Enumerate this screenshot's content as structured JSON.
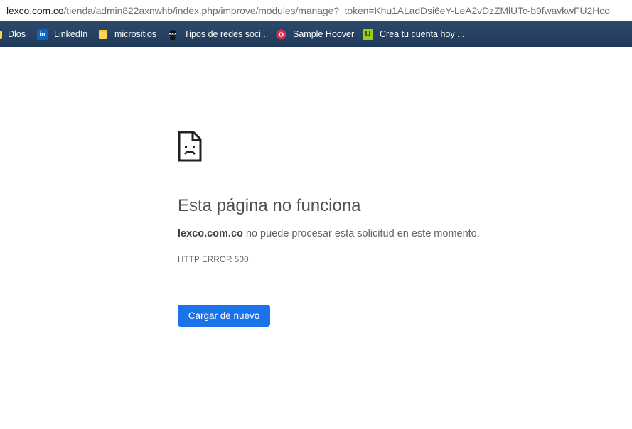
{
  "address_bar": {
    "url_domain": "lexco.com.co",
    "url_path": "/tienda/admin822axnwhb/index.php/improve/modules/manage?_token=Khu1ALadDsi6eY-LeA2vDzZMlUTc-b9fwavkwFU2Hco"
  },
  "bookmarks": {
    "items": [
      {
        "label": "Dlos",
        "icon": "bookmark-clip-icon"
      },
      {
        "label": "LinkedIn",
        "icon": "linkedin-icon",
        "icon_text": "in"
      },
      {
        "label": "micrositios",
        "icon": "folder-icon"
      },
      {
        "label": "Tipos de redes soci...",
        "icon": "ninja-icon"
      },
      {
        "label": "Sample Hoover",
        "icon": "hoover-icon"
      },
      {
        "label": "Crea tu cuenta hoy ...",
        "icon": "u-logo-icon",
        "icon_text": "U"
      }
    ]
  },
  "error_page": {
    "icon": "sad-page-icon",
    "title": "Esta página no funciona",
    "message_domain": "lexco.com.co",
    "message_text": " no puede procesar esta solicitud en este momento.",
    "error_code": "HTTP ERROR 500",
    "reload_label": "Cargar de nuevo"
  },
  "colors": {
    "bookmarks_bar": "#20395a",
    "button": "#1a73e8",
    "title_text": "#4d5156"
  }
}
